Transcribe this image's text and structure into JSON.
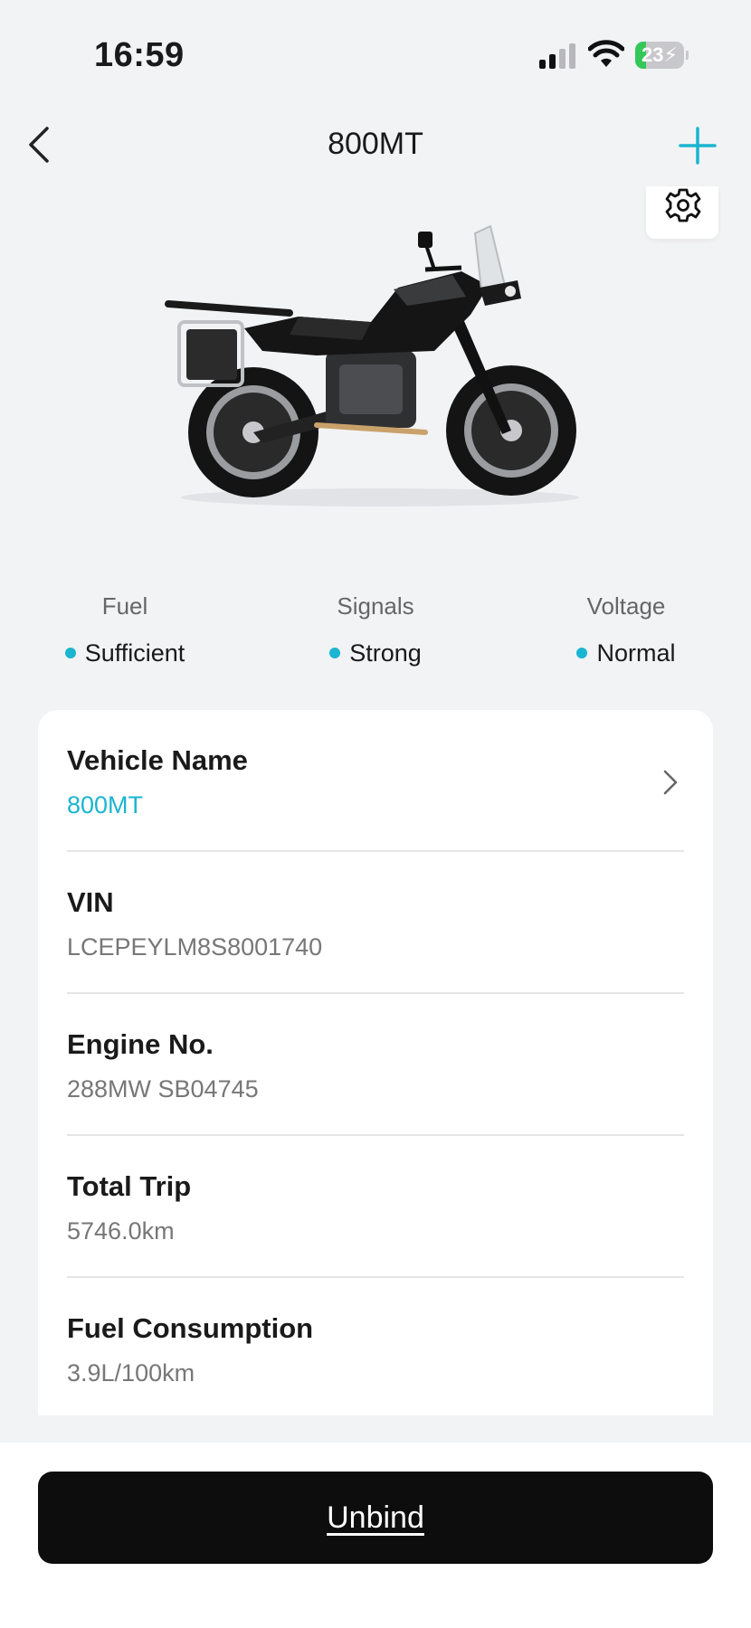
{
  "status_bar": {
    "time": "16:59",
    "battery_level": "23",
    "battery_fraction": 0.23,
    "battery_charging": true,
    "icons": [
      "cellular-signal-icon",
      "wifi-icon",
      "battery-icon"
    ]
  },
  "nav": {
    "title": "800MT",
    "back_icon": "chevron-left-icon",
    "add_icon": "plus-icon",
    "accent_color": "#1ab5d0"
  },
  "hero": {
    "settings_icon": "gear-icon",
    "image": "motorcycle-image"
  },
  "stats": [
    {
      "label": "Fuel",
      "value": "Sufficient"
    },
    {
      "label": "Signals",
      "value": "Strong"
    },
    {
      "label": "Voltage",
      "value": "Normal"
    }
  ],
  "info": {
    "vehicle_name": {
      "label": "Vehicle Name",
      "value": "800MT"
    },
    "vin": {
      "label": "VIN",
      "value": "LCEPEYLM8S8001740"
    },
    "engine_no": {
      "label": "Engine No.",
      "value": "288MW SB04745"
    },
    "total_trip": {
      "label": "Total Trip",
      "value": "5746.0km"
    },
    "fuel_consumption": {
      "label": "Fuel Consumption",
      "value": "3.9L/100km"
    }
  },
  "footer": {
    "unbind_label": "Unbind"
  }
}
